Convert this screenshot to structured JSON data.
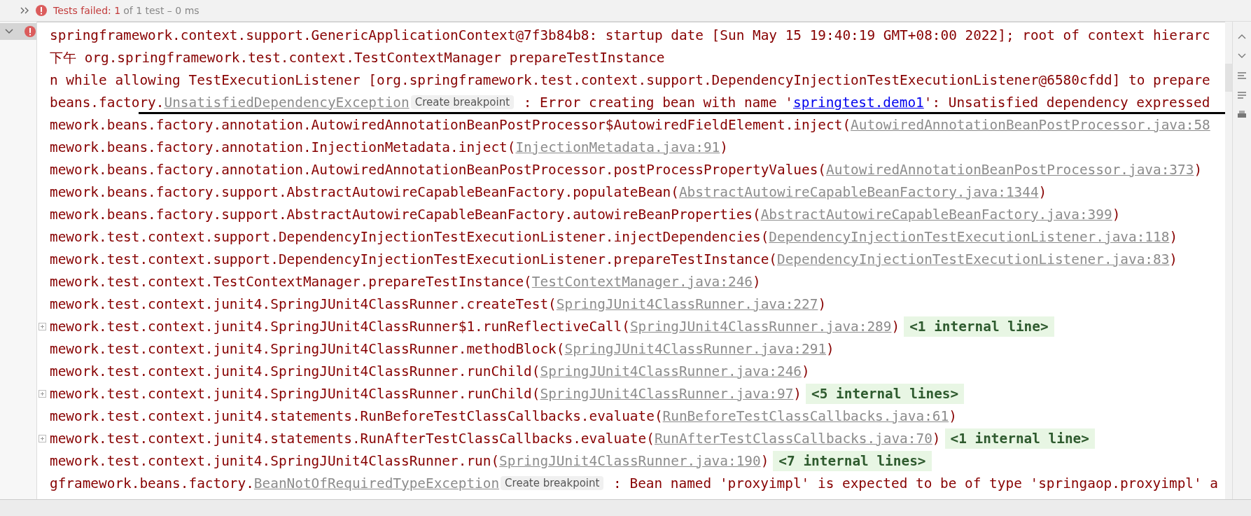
{
  "header": {
    "failed": "Tests failed: 1",
    "summary": "of 1 test – 0 ms"
  },
  "tree": {
    "expanded": true,
    "failed": true,
    "selected": true
  },
  "console": {
    "rows": [
      {
        "segments": [
          {
            "kind": "text",
            "text": "springframework.context.support.GenericApplicationContext@7f3b84b8: startup date [Sun May 15 19:40:19 GMT+08:00 2022]; root of context hierarc"
          }
        ]
      },
      {
        "segments": [
          {
            "kind": "cjk",
            "text": "下午"
          },
          {
            "kind": "text",
            "text": " org.springframework.test.context.TestContextManager prepareTestInstance"
          }
        ]
      },
      {
        "segments": [
          {
            "kind": "text",
            "text": "n while allowing TestExecutionListener [org.springframework.test.context.support.DependencyInjectionTestExecutionListener@6580cfdd] to prepare"
          }
        ]
      },
      {
        "rule": true,
        "segments": [
          {
            "kind": "text",
            "text": "beans.factory."
          },
          {
            "kind": "file",
            "text": "UnsatisfiedDependencyException"
          },
          {
            "kind": "tip",
            "text": "Create breakpoint"
          },
          {
            "kind": "text",
            "text": " : Error creating bean with name '"
          },
          {
            "kind": "link",
            "text": "springtest.demo1"
          },
          {
            "kind": "text",
            "text": "': Unsatisfied dependency expressed"
          }
        ]
      },
      {
        "segments": [
          {
            "kind": "text",
            "text": "mework.beans.factory.annotation.AutowiredAnnotationBeanPostProcessor$AutowiredFieldElement.inject("
          },
          {
            "kind": "file",
            "text": "AutowiredAnnotationBeanPostProcessor.java:58"
          }
        ]
      },
      {
        "segments": [
          {
            "kind": "text",
            "text": "mework.beans.factory.annotation.InjectionMetadata.inject("
          },
          {
            "kind": "file",
            "text": "InjectionMetadata.java:91"
          },
          {
            "kind": "text",
            "text": ")"
          }
        ]
      },
      {
        "segments": [
          {
            "kind": "text",
            "text": "mework.beans.factory.annotation.AutowiredAnnotationBeanPostProcessor.postProcessPropertyValues("
          },
          {
            "kind": "file",
            "text": "AutowiredAnnotationBeanPostProcessor.java:373"
          },
          {
            "kind": "text",
            "text": ")"
          }
        ]
      },
      {
        "segments": [
          {
            "kind": "text",
            "text": "mework.beans.factory.support.AbstractAutowireCapableBeanFactory.populateBean("
          },
          {
            "kind": "file",
            "text": "AbstractAutowireCapableBeanFactory.java:1344"
          },
          {
            "kind": "text",
            "text": ")"
          }
        ]
      },
      {
        "segments": [
          {
            "kind": "text",
            "text": "mework.beans.factory.support.AbstractAutowireCapableBeanFactory.autowireBeanProperties("
          },
          {
            "kind": "file",
            "text": "AbstractAutowireCapableBeanFactory.java:399"
          },
          {
            "kind": "text",
            "text": ")"
          }
        ]
      },
      {
        "segments": [
          {
            "kind": "text",
            "text": "mework.test.context.support.DependencyInjectionTestExecutionListener.injectDependencies("
          },
          {
            "kind": "file",
            "text": "DependencyInjectionTestExecutionListener.java:118"
          },
          {
            "kind": "text",
            "text": ")"
          }
        ]
      },
      {
        "segments": [
          {
            "kind": "text",
            "text": "mework.test.context.support.DependencyInjectionTestExecutionListener.prepareTestInstance("
          },
          {
            "kind": "file",
            "text": "DependencyInjectionTestExecutionListener.java:83"
          },
          {
            "kind": "text",
            "text": ")"
          }
        ]
      },
      {
        "segments": [
          {
            "kind": "text",
            "text": "mework.test.context.TestContextManager.prepareTestInstance("
          },
          {
            "kind": "file",
            "text": "TestContextManager.java:246"
          },
          {
            "kind": "text",
            "text": ")"
          }
        ]
      },
      {
        "segments": [
          {
            "kind": "text",
            "text": "mework.test.context.junit4.SpringJUnit4ClassRunner.createTest("
          },
          {
            "kind": "file",
            "text": "SpringJUnit4ClassRunner.java:227"
          },
          {
            "kind": "text",
            "text": ")"
          }
        ]
      },
      {
        "foldable": true,
        "segments": [
          {
            "kind": "text",
            "text": "mework.test.context.junit4.SpringJUnit4ClassRunner$1.runReflectiveCall("
          },
          {
            "kind": "file",
            "text": "SpringJUnit4ClassRunner.java:289"
          },
          {
            "kind": "text",
            "text": ")"
          },
          {
            "kind": "fold",
            "text": "<1 internal line>"
          }
        ]
      },
      {
        "segments": [
          {
            "kind": "text",
            "text": "mework.test.context.junit4.SpringJUnit4ClassRunner.methodBlock("
          },
          {
            "kind": "file",
            "text": "SpringJUnit4ClassRunner.java:291"
          },
          {
            "kind": "text",
            "text": ")"
          }
        ]
      },
      {
        "segments": [
          {
            "kind": "text",
            "text": "mework.test.context.junit4.SpringJUnit4ClassRunner.runChild("
          },
          {
            "kind": "file",
            "text": "SpringJUnit4ClassRunner.java:246"
          },
          {
            "kind": "text",
            "text": ")"
          }
        ]
      },
      {
        "foldable": true,
        "segments": [
          {
            "kind": "text",
            "text": "mework.test.context.junit4.SpringJUnit4ClassRunner.runChild("
          },
          {
            "kind": "file",
            "text": "SpringJUnit4ClassRunner.java:97"
          },
          {
            "kind": "text",
            "text": ")"
          },
          {
            "kind": "fold",
            "text": "<5 internal lines>"
          }
        ]
      },
      {
        "segments": [
          {
            "kind": "text",
            "text": "mework.test.context.junit4.statements.RunBeforeTestClassCallbacks.evaluate("
          },
          {
            "kind": "file",
            "text": "RunBeforeTestClassCallbacks.java:61"
          },
          {
            "kind": "text",
            "text": ")"
          }
        ]
      },
      {
        "foldable": true,
        "segments": [
          {
            "kind": "text",
            "text": "mework.test.context.junit4.statements.RunAfterTestClassCallbacks.evaluate("
          },
          {
            "kind": "file",
            "text": "RunAfterTestClassCallbacks.java:70"
          },
          {
            "kind": "text",
            "text": ")"
          },
          {
            "kind": "fold",
            "text": "<1 internal line>"
          }
        ]
      },
      {
        "segments": [
          {
            "kind": "text",
            "text": "mework.test.context.junit4.SpringJUnit4ClassRunner.run("
          },
          {
            "kind": "file",
            "text": "SpringJUnit4ClassRunner.java:190"
          },
          {
            "kind": "text",
            "text": ")"
          },
          {
            "kind": "fold",
            "text": "<7 internal lines>"
          }
        ]
      },
      {
        "segments": [
          {
            "kind": "text",
            "text": "gframework.beans.factory."
          },
          {
            "kind": "file",
            "text": "BeanNotOfRequiredTypeException"
          },
          {
            "kind": "tip",
            "text": "Create breakpoint"
          },
          {
            "kind": "text",
            "text": " : Bean named 'proxyimpl' is expected to be of type 'springaop.proxyimpl' a"
          }
        ]
      }
    ]
  }
}
